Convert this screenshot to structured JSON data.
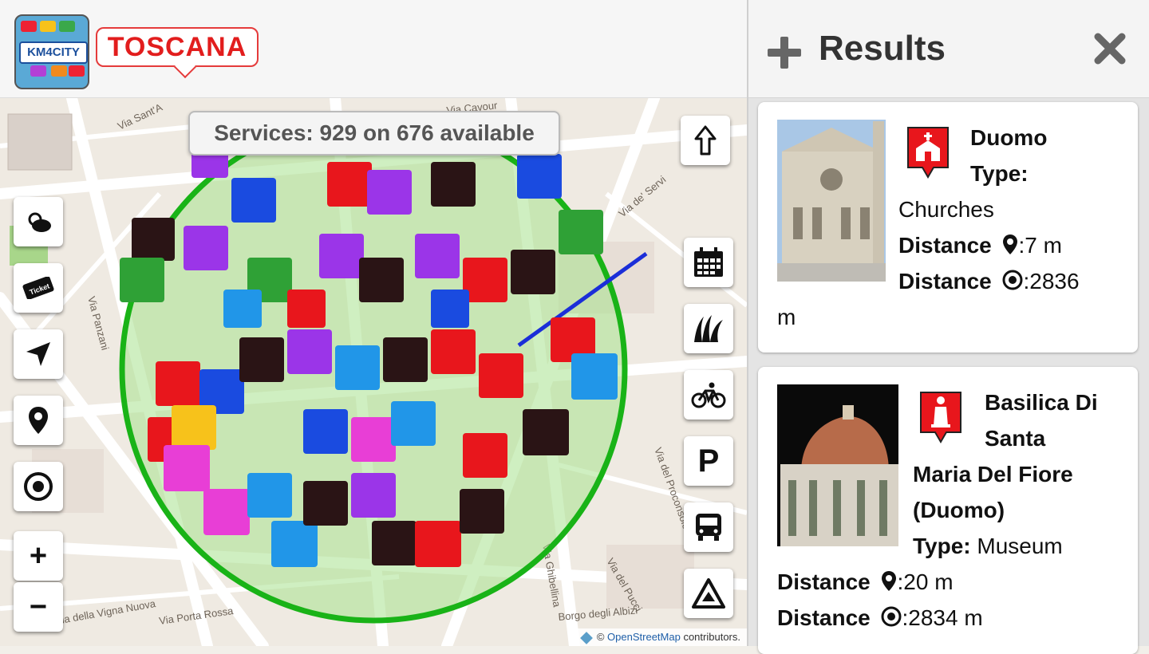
{
  "header": {
    "logo_km": "KM4CITY",
    "logo_region": "TOSCANA"
  },
  "map": {
    "services_label": "Services: 929 on 676 available",
    "attribution_prefix": "©",
    "attribution_link": "OpenStreetMap",
    "attribution_suffix": "contributors.",
    "street_labels": [
      "Via Sant'A",
      "Via Panzani",
      "Via della Vigna Nuova",
      "Via Porta Rossa",
      "Borgo degli Albizi",
      "Via del Pucci",
      "Via Ghibellina",
      "Via de' Servi",
      "Via Cavour",
      "Via del Proconsolo"
    ],
    "left_controls": [
      "weather-icon",
      "ticket-icon",
      "navigate-icon",
      "location-pin-icon",
      "target-icon"
    ],
    "zoom_in": "+",
    "zoom_out": "−",
    "right_controls": [
      "up-arrow-icon",
      "calendar-icon",
      "grass-icon",
      "bicycle-icon",
      "parking-icon",
      "bus-icon",
      "warning-icon"
    ],
    "parking_label": "P"
  },
  "panel": {
    "title": "Results",
    "results": [
      {
        "name": "Duomo",
        "type_label": "Type:",
        "type_value": "Churches",
        "distance_label": "Distance",
        "distance_walk": ":7 m",
        "distance_label_2": "Distance",
        "distance_target": ":2836",
        "distance_target_unit": "m"
      },
      {
        "name_line1": "Basilica Di",
        "name_line2": "Santa",
        "name_line3": "Maria Del Fiore",
        "name_line4": "(Duomo)",
        "type_label": "Type:",
        "type_value": "Museum",
        "distance_label": "Distance",
        "distance_walk": ":20 m",
        "distance_label_2": "Distance",
        "distance_target": ":2834 m"
      }
    ]
  },
  "colors": {
    "accent_red": "#e21d1d",
    "radius_green": "#1fb51f",
    "pin_red": "#e8161c"
  }
}
